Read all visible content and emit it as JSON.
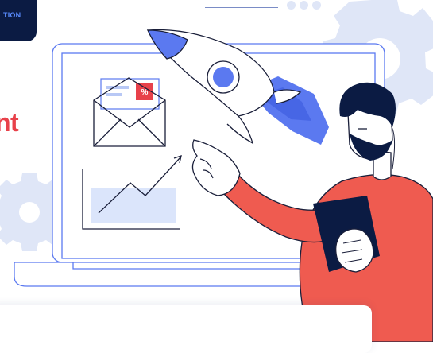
{
  "badge": {
    "label": "TION"
  },
  "headline": {
    "text": "nt"
  },
  "colors": {
    "accent_red": "#e8414a",
    "brand_blue": "#5b79f0",
    "navy": "#0b1b43",
    "soft_blue": "#dbe5fb",
    "outline": "#1a1f3a"
  },
  "icons": {
    "rocket": "rocket-icon",
    "envelope": "envelope-icon",
    "discount": "discount-tag-icon",
    "chart": "growth-chart-icon",
    "gear": "gear-icon",
    "tablet": "tablet-icon"
  }
}
